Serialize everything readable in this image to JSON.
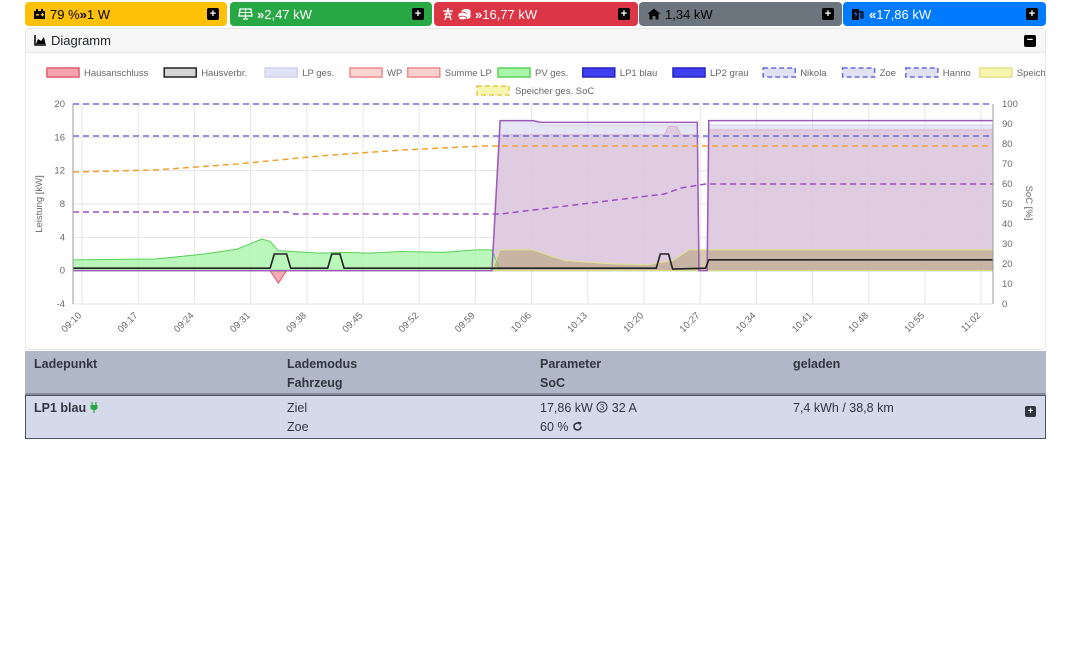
{
  "topbar": {
    "battery": {
      "value": "79 % ",
      "power": " 1 W",
      "icon": "battery-car-icon"
    },
    "pv": {
      "power": " 2,47 kW",
      "icon": "solar-panel-icon"
    },
    "grid": {
      "power": " 16,77 kW",
      "icon": "power-tower-icon"
    },
    "house": {
      "power": "1,34 kW",
      "icon": "home-icon"
    },
    "charge": {
      "power": " 17,86 kW",
      "icon": "charging-station-icon"
    }
  },
  "diagram": {
    "title": "Diagramm",
    "icon": "area-chart-icon"
  },
  "chart_data": {
    "type": "area",
    "ylabel": "Leistung [kW]",
    "y2label": "SoC [%]",
    "ylim": [
      -4,
      20
    ],
    "y2lim": [
      0,
      100
    ],
    "yticks": [
      "-4",
      "0",
      "4",
      "8",
      "12",
      "16",
      "20"
    ],
    "y2ticks": [
      "0",
      "10",
      "20",
      "30",
      "40",
      "50",
      "60",
      "70",
      "80",
      "90",
      "100"
    ],
    "x_ticks": [
      "09:10",
      "09:17",
      "09:24",
      "09:31",
      "09:38",
      "09:45",
      "09:52",
      "09:59",
      "10:06",
      "10:13",
      "10:20",
      "10:27",
      "10:34",
      "10:41",
      "10:48",
      "10:55",
      "11:02"
    ],
    "legend": [
      {
        "name": "Hausanschluss",
        "fill": "#f4a3b0",
        "stroke": "#e05c6e",
        "dash": false
      },
      {
        "name": "Hausverbr.",
        "fill": "#d4d4d4",
        "stroke": "#222222",
        "dash": false
      },
      {
        "name": "LP ges.",
        "fill": "#e2e2f6",
        "stroke": "#d2d2ee",
        "dash": false
      },
      {
        "name": "WP",
        "fill": "#fbd4d4",
        "stroke": "#f08a8a",
        "dash": false
      },
      {
        "name": "Summe LP",
        "fill": "#fbd0d0",
        "stroke": "#ee8888",
        "dash": false
      },
      {
        "name": "PV ges.",
        "fill": "#a9f5a9",
        "stroke": "#5ad05a",
        "dash": false
      },
      {
        "name": "LP1 blau",
        "fill": "#4040f0",
        "stroke": "#2222bb",
        "dash": false
      },
      {
        "name": "LP2 grau",
        "fill": "#4040f0",
        "stroke": "#2222bb",
        "dash": false
      },
      {
        "name": "Nikola",
        "fill": "#e2e2f6",
        "stroke": "#6a6ad8",
        "dash": true
      },
      {
        "name": "Zoe",
        "fill": "#e2e2f6",
        "stroke": "#6a6ad8",
        "dash": true
      },
      {
        "name": "Hanno",
        "fill": "#e2e2f6",
        "stroke": "#6a6ad8",
        "dash": true
      },
      {
        "name": "Speicher ges.",
        "fill": "#f6f6b0",
        "stroke": "#e2e28a",
        "dash": false
      },
      {
        "name": "Speicher ges. SoC",
        "fill": "#f6f6b0",
        "stroke": "#e6c84a",
        "dash": true
      }
    ],
    "series": [
      {
        "name": "Hausanschluss",
        "points": [
          [
            0,
            0
          ],
          [
            24,
            0
          ],
          [
            25,
            -1.5
          ],
          [
            26,
            0
          ],
          [
            51,
            0
          ],
          [
            52,
            16.3
          ],
          [
            72,
            16.3
          ],
          [
            72.5,
            17.3
          ],
          [
            73.5,
            17.3
          ],
          [
            74,
            16.3
          ],
          [
            76,
            16.3
          ],
          [
            76.2,
            0
          ],
          [
            77.2,
            0
          ],
          [
            77.4,
            16.9
          ],
          [
            112,
            16.9
          ]
        ]
      },
      {
        "name": "LP ges.",
        "points": [
          [
            0,
            0
          ],
          [
            51,
            0
          ],
          [
            52,
            18
          ],
          [
            56,
            18
          ],
          [
            57,
            17.5
          ],
          [
            75,
            17.5
          ],
          [
            76,
            17.5
          ],
          [
            76.2,
            0
          ],
          [
            77.2,
            0
          ],
          [
            77.4,
            17.5
          ],
          [
            112,
            17.5
          ]
        ]
      },
      {
        "name": "PV ges.",
        "points": [
          [
            0,
            1.3
          ],
          [
            10,
            1.4
          ],
          [
            16,
            2
          ],
          [
            20,
            2.6
          ],
          [
            22,
            3.4
          ],
          [
            23,
            3.8
          ],
          [
            24,
            3.5
          ],
          [
            25,
            2.4
          ],
          [
            30,
            2.1
          ],
          [
            33,
            2.2
          ],
          [
            36,
            2.1
          ],
          [
            40,
            2.3
          ],
          [
            45,
            2.2
          ],
          [
            49,
            2.5
          ],
          [
            51,
            2.5
          ],
          [
            52,
            0
          ],
          [
            112,
            0
          ]
        ]
      },
      {
        "name": "Hausverbr.",
        "points": [
          [
            0,
            0.3
          ],
          [
            24,
            0.3
          ],
          [
            24.5,
            2
          ],
          [
            26,
            2
          ],
          [
            26.5,
            0.3
          ],
          [
            31,
            0.3
          ],
          [
            31.5,
            2
          ],
          [
            32.5,
            2
          ],
          [
            33,
            0.3
          ],
          [
            51,
            0.3
          ],
          [
            53,
            0.3
          ],
          [
            55,
            0.3
          ],
          [
            70,
            0.3
          ],
          [
            71,
            0.3
          ],
          [
            71.5,
            2
          ],
          [
            72.5,
            2
          ],
          [
            73,
            0.2
          ],
          [
            77,
            0.3
          ],
          [
            77.4,
            1.3
          ],
          [
            112,
            1.3
          ]
        ]
      },
      {
        "name": "Speicher ges.",
        "points": [
          [
            51,
            0
          ],
          [
            52,
            2.5
          ],
          [
            56,
            2.5
          ],
          [
            58,
            1.8
          ],
          [
            60,
            1.2
          ],
          [
            66,
            0.8
          ],
          [
            70,
            0.7
          ],
          [
            73,
            1.2
          ],
          [
            75,
            2.5
          ],
          [
            112,
            2.5
          ]
        ]
      },
      {
        "name": "LP1 blau",
        "points": [
          [
            0,
            0
          ],
          [
            51,
            0
          ],
          [
            52,
            18
          ],
          [
            56,
            18
          ],
          [
            57,
            17.8
          ],
          [
            76,
            17.8
          ],
          [
            76.2,
            0
          ],
          [
            77.2,
            0
          ],
          [
            77.4,
            18
          ],
          [
            112,
            18
          ]
        ]
      },
      {
        "name": "Summe LP",
        "points": [
          [
            0,
            0
          ],
          [
            76,
            0
          ],
          [
            76.2,
            0
          ],
          [
            112,
            0
          ]
        ]
      }
    ],
    "soc_series": [
      {
        "name": "Speicher ges. SoC",
        "points": [
          [
            0,
            66
          ],
          [
            10,
            67
          ],
          [
            20,
            70
          ],
          [
            30,
            74
          ],
          [
            40,
            77
          ],
          [
            50,
            79
          ],
          [
            55,
            79
          ],
          [
            65,
            79
          ],
          [
            80,
            79
          ],
          [
            112,
            79
          ]
        ]
      },
      {
        "name": "Nikola",
        "points": [
          [
            0,
            84
          ],
          [
            112,
            84
          ]
        ]
      },
      {
        "name": "Zoe",
        "points": [
          [
            0,
            46
          ],
          [
            26,
            46
          ],
          [
            27,
            45
          ],
          [
            48,
            45
          ],
          [
            52,
            45
          ],
          [
            54,
            46
          ],
          [
            56,
            47
          ],
          [
            60,
            49
          ],
          [
            64,
            51
          ],
          [
            68,
            53
          ],
          [
            72,
            55
          ],
          [
            74,
            58
          ],
          [
            77,
            60
          ],
          [
            112,
            60
          ]
        ]
      },
      {
        "name": "Hanno",
        "points": [
          [
            0,
            100
          ],
          [
            112,
            100
          ]
        ]
      }
    ],
    "x_range_minutes": [
      0,
      112
    ],
    "grid": true,
    "legend_position": "top"
  },
  "table": {
    "headers": {
      "col1": "Ladepunkt",
      "col2_a": "Lademodus",
      "col2_b": "Fahrzeug",
      "col3_a": "Parameter",
      "col3_b": "SoC",
      "col4": "geladen"
    },
    "rows": [
      {
        "name": "LP1 blau",
        "mode": "Ziel",
        "vehicle": "Zoe",
        "power": "17,86 kW",
        "phases_icon": "phase-3-icon",
        "current": " 32 A",
        "soc": "60 %",
        "charged": "7,4 kWh / 38,8 km"
      }
    ]
  }
}
